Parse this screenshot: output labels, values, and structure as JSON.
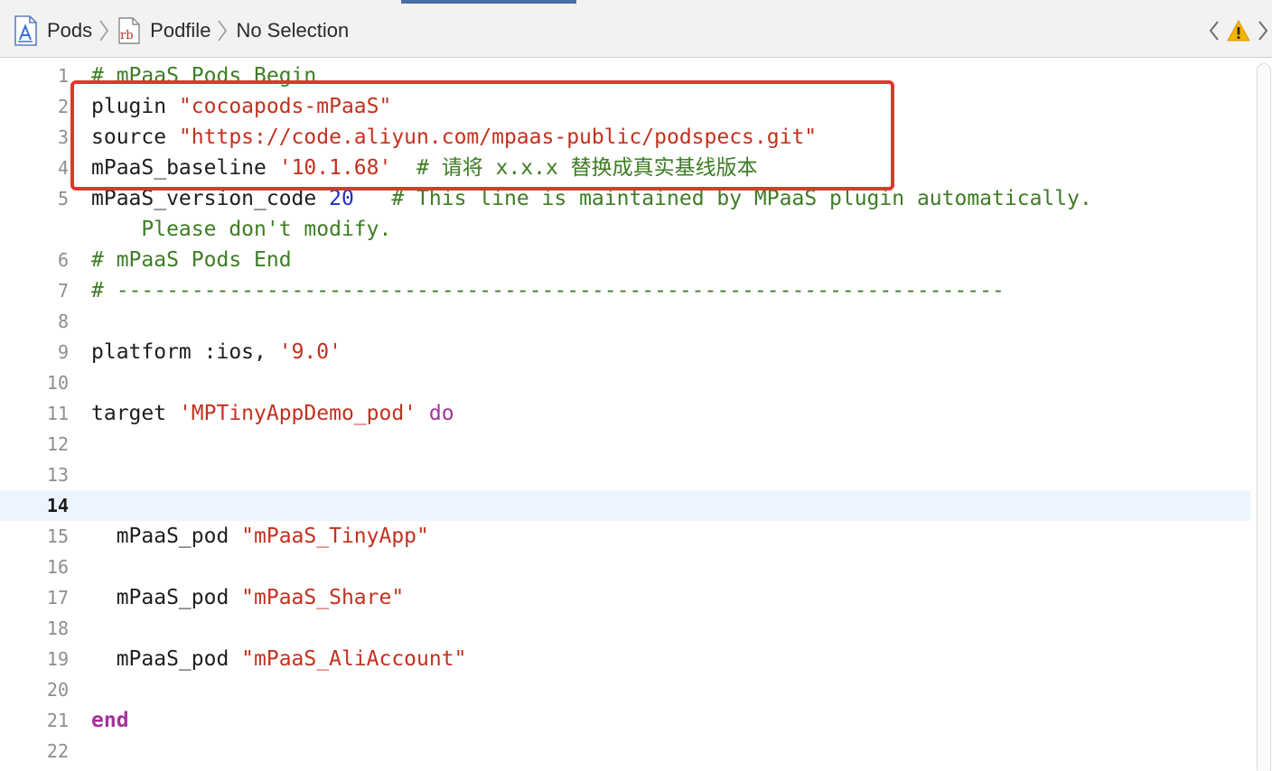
{
  "jumpbar": {
    "crumbs": [
      {
        "label": "Pods",
        "icon": "xcodeproj-icon"
      },
      {
        "label": "Podfile",
        "icon": "ruby-file-icon"
      },
      {
        "label": "No Selection"
      }
    ],
    "rb_icon_text": "rb"
  },
  "colors": {
    "string": "#c4301e",
    "comment": "#3d7d23",
    "number": "#1f30c8",
    "keyword": "#a3329c",
    "annotation": "#e0372c",
    "current_line": "#ecf5ff"
  },
  "editor": {
    "current_line": 14,
    "lines": [
      {
        "num": "1",
        "parts": [
          {
            "t": "comment",
            "s": "# mPaaS Pods Begin"
          }
        ]
      },
      {
        "num": "2",
        "parts": [
          {
            "t": "plain",
            "s": "plugin "
          },
          {
            "t": "string",
            "s": "\"cocoapods-mPaaS\""
          }
        ]
      },
      {
        "num": "3",
        "parts": [
          {
            "t": "plain",
            "s": "source "
          },
          {
            "t": "string",
            "s": "\"https://code.aliyun.com/mpaas-public/podspecs.git\""
          }
        ]
      },
      {
        "num": "4",
        "parts": [
          {
            "t": "plain",
            "s": "mPaaS_baseline "
          },
          {
            "t": "string",
            "s": "'10.1.68'"
          },
          {
            "t": "plain",
            "s": "  "
          },
          {
            "t": "comment",
            "s": "# 请将 x.x.x 替换成真实基线版本"
          }
        ]
      },
      {
        "num": "5",
        "parts": [
          {
            "t": "plain",
            "s": "mPaaS_version_code "
          },
          {
            "t": "number",
            "s": "20"
          },
          {
            "t": "plain",
            "s": "   "
          },
          {
            "t": "comment",
            "s": "# This line is maintained by MPaaS plugin automatically."
          }
        ]
      },
      {
        "num": "",
        "parts": [
          {
            "t": "comment",
            "s": "    Please don't modify."
          }
        ]
      },
      {
        "num": "6",
        "parts": [
          {
            "t": "comment",
            "s": "# mPaaS Pods End"
          }
        ]
      },
      {
        "num": "7",
        "parts": [
          {
            "t": "comment",
            "s": "# -----------------------------------------------------------------------"
          }
        ]
      },
      {
        "num": "8",
        "parts": []
      },
      {
        "num": "9",
        "parts": [
          {
            "t": "plain",
            "s": "platform :ios, "
          },
          {
            "t": "string",
            "s": "'9.0'"
          }
        ]
      },
      {
        "num": "10",
        "parts": []
      },
      {
        "num": "11",
        "parts": [
          {
            "t": "plain",
            "s": "target "
          },
          {
            "t": "string",
            "s": "'MPTinyAppDemo_pod'"
          },
          {
            "t": "plain",
            "s": " "
          },
          {
            "t": "keyword",
            "s": "do"
          }
        ]
      },
      {
        "num": "12",
        "parts": []
      },
      {
        "num": "13",
        "parts": []
      },
      {
        "num": "14",
        "parts": []
      },
      {
        "num": "15",
        "parts": [
          {
            "t": "plain",
            "s": "  mPaaS_pod "
          },
          {
            "t": "string",
            "s": "\"mPaaS_TinyApp\""
          }
        ]
      },
      {
        "num": "16",
        "parts": []
      },
      {
        "num": "17",
        "parts": [
          {
            "t": "plain",
            "s": "  mPaaS_pod "
          },
          {
            "t": "string",
            "s": "\"mPaaS_Share\""
          }
        ]
      },
      {
        "num": "18",
        "parts": []
      },
      {
        "num": "19",
        "parts": [
          {
            "t": "plain",
            "s": "  mPaaS_pod "
          },
          {
            "t": "string",
            "s": "\"mPaaS_AliAccount\""
          }
        ]
      },
      {
        "num": "20",
        "parts": []
      },
      {
        "num": "21",
        "parts": [
          {
            "t": "keyword-bold",
            "s": "end"
          }
        ]
      },
      {
        "num": "22",
        "parts": []
      }
    ]
  }
}
